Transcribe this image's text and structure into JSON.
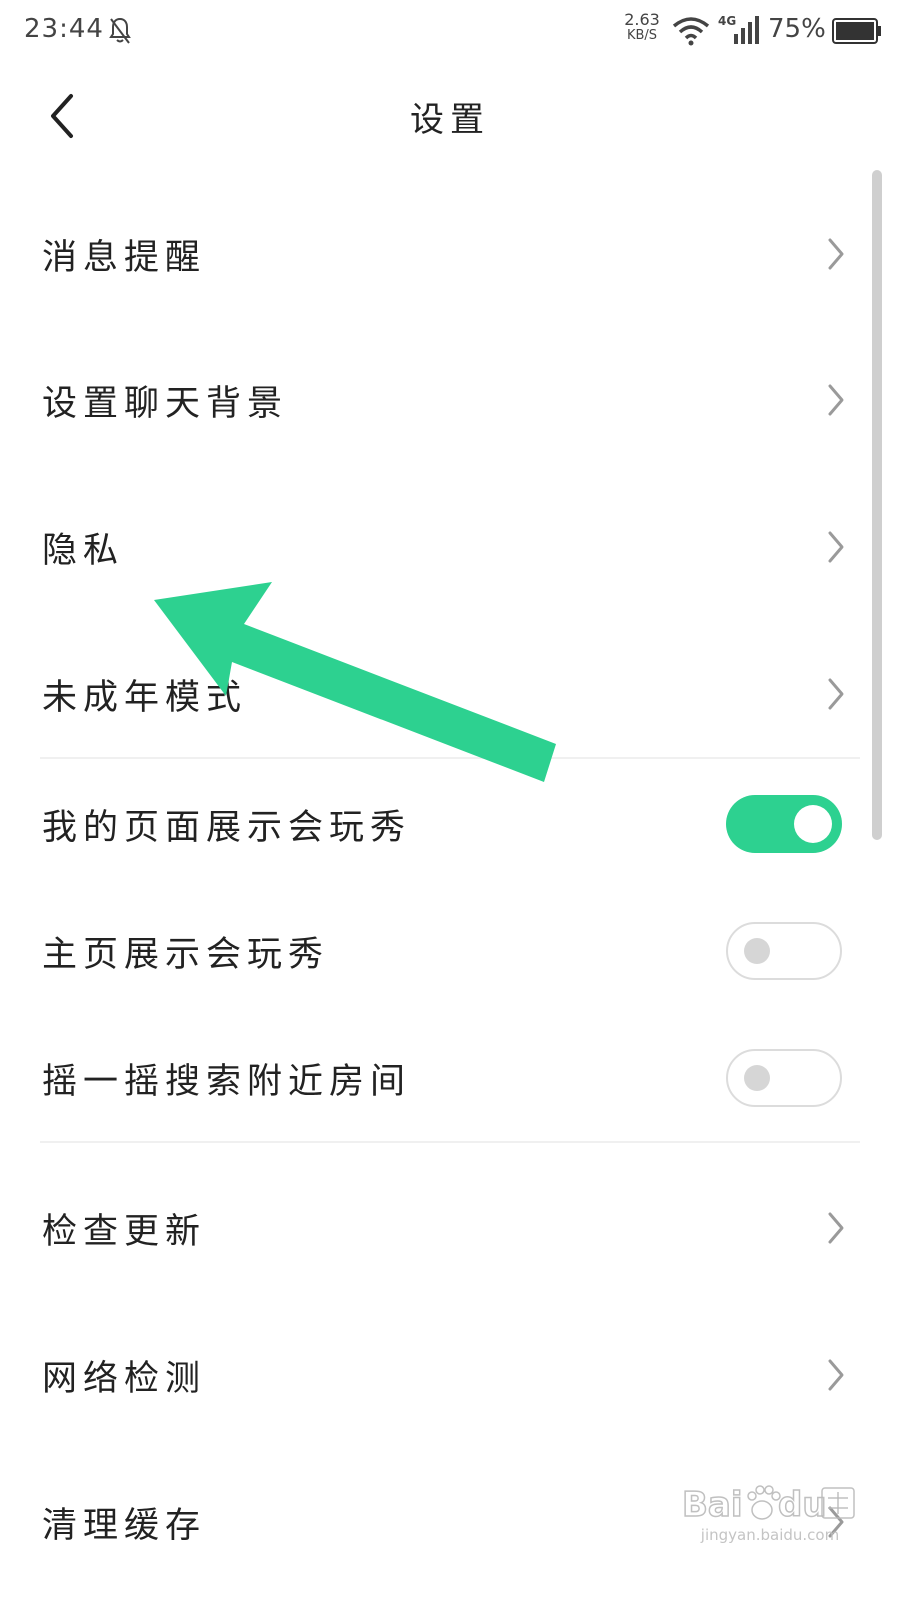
{
  "status_bar": {
    "time": "23:44",
    "net_speed_value": "2.63",
    "net_speed_unit": "KB/S",
    "network_type": "4G",
    "battery": "75%"
  },
  "header": {
    "title": "设置"
  },
  "settings": {
    "message_reminder": "消息提醒",
    "chat_background": "设置聊天背景",
    "privacy": "隐私",
    "minor_mode": "未成年模式",
    "show_on_my_page": {
      "label": "我的页面展示会玩秀",
      "enabled": true
    },
    "show_on_homepage": {
      "label": "主页展示会玩秀",
      "enabled": false
    },
    "shake_search_nearby": {
      "label": "摇一摇搜索附近房间",
      "enabled": false
    },
    "check_update": "检查更新",
    "network_check": "网络检测",
    "clear_cache": "清理缓存"
  },
  "colors": {
    "accent": "#2dd190",
    "arrow": "#2dd190"
  },
  "watermark": {
    "url": "jingyan.baidu.com"
  }
}
